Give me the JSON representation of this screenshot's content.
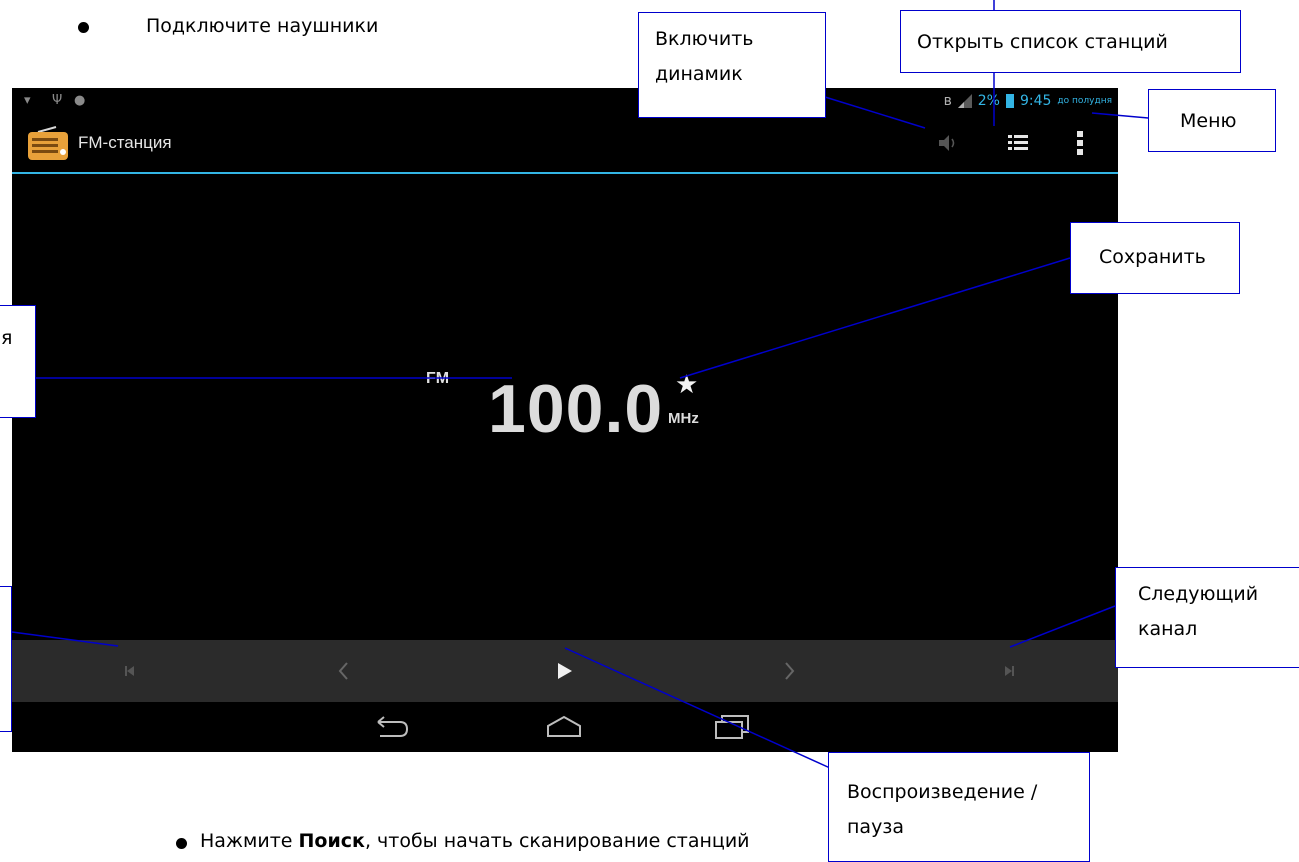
{
  "doc": {
    "bullet_top": "Подключите наушники",
    "bullet_bottom_prefix": "Нажмите ",
    "bullet_bottom_bold": "Поиск",
    "bullet_bottom_rest": ", чтобы начать сканирование станций"
  },
  "status_bar": {
    "battery_percent": "2%",
    "time": "9:45",
    "ampm": "до полудня",
    "colors": {
      "accent": "#33b5e5"
    },
    "left_icons": [
      "wifi-icon",
      "usb-icon",
      "android-icon"
    ],
    "right_icons": [
      "bluetooth-icon",
      "signal-icon",
      "battery-icon"
    ]
  },
  "action_bar": {
    "title": "FM-станция",
    "app_icon": "radio-icon",
    "actions": [
      "speaker-icon",
      "station-list-icon",
      "overflow-menu-icon"
    ]
  },
  "tuner": {
    "band": "FM",
    "frequency": "100.0",
    "unit": "MHz",
    "favorite_icon": "star-icon"
  },
  "controls": [
    "previous-station-icon",
    "seek-back-icon",
    "play-icon",
    "seek-forward-icon",
    "next-station-icon"
  ],
  "nav_bar": [
    "back-icon",
    "home-icon",
    "recent-apps-icon"
  ],
  "callouts": {
    "speaker": "Включить динамик",
    "station_list": "Открыть список станций",
    "menu": "Меню",
    "save": "Сохранить",
    "frequency_partial": "я",
    "next_channel": "Следующий канал",
    "play_pause": "Воспроизведение /пауза"
  }
}
